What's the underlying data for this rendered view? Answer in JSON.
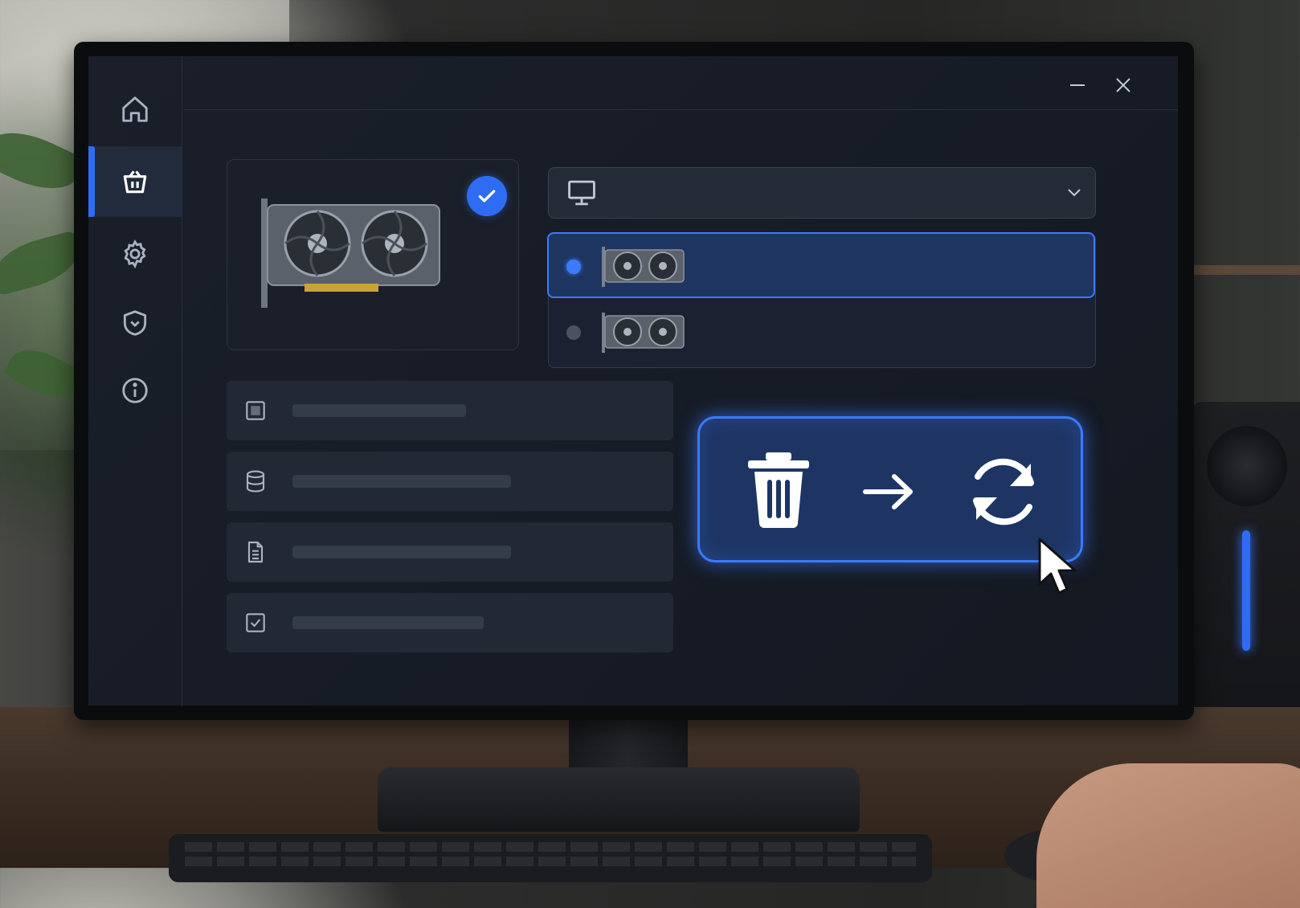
{
  "sidebar": {
    "items": [
      {
        "name": "home",
        "icon": "home-icon",
        "active": false
      },
      {
        "name": "cleanup",
        "icon": "shopping-basket-icon",
        "active": true
      },
      {
        "name": "settings",
        "icon": "gear-icon",
        "active": false
      },
      {
        "name": "security",
        "icon": "shield-icon",
        "active": false
      },
      {
        "name": "about",
        "icon": "info-icon",
        "active": false
      }
    ]
  },
  "window_controls": {
    "minimize": "minimize-icon",
    "close": "close-icon"
  },
  "gpu_card": {
    "selected": true,
    "icon": "graphics-card-icon"
  },
  "display_dropdown": {
    "icon": "monitor-icon",
    "value": ""
  },
  "devices": [
    {
      "selected": true,
      "icon": "graphics-card-icon"
    },
    {
      "selected": false,
      "icon": "graphics-card-icon"
    }
  ],
  "options": [
    {
      "icon": "chip-icon",
      "fill": 0.39
    },
    {
      "icon": "database-icon",
      "fill": 0.49
    },
    {
      "icon": "document-icon",
      "fill": 0.49
    },
    {
      "icon": "checkbox-icon",
      "fill": 0.43
    }
  ],
  "action_button": {
    "icons": [
      "trash-icon",
      "arrow-right-icon",
      "refresh-icon"
    ]
  },
  "colors": {
    "accent": "#3b7bff",
    "background": "#161b25",
    "panel": "#222834"
  }
}
